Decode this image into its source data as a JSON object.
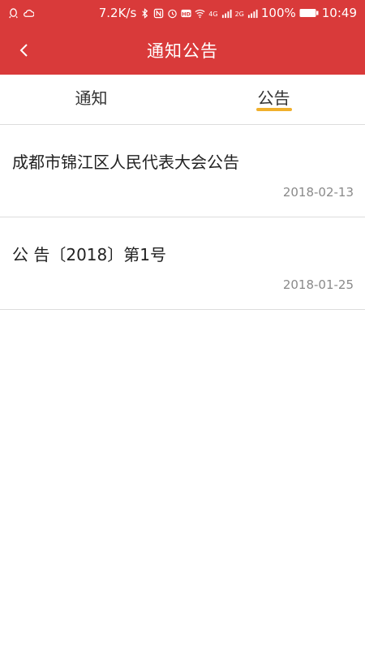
{
  "status_bar": {
    "speed": "7.2K/s",
    "network_4g": "4G",
    "network_2g": "2G",
    "battery": "100%",
    "time": "10:49",
    "icons": [
      "qq-icon",
      "cloud-icon",
      "bluetooth-icon",
      "nfc-icon",
      "alarm-icon",
      "hd-icon",
      "wifi-icon",
      "signal-icon",
      "battery-icon"
    ]
  },
  "header": {
    "title": "通知公告",
    "back_icon": "chevron-left-icon"
  },
  "tabs": [
    {
      "label": "通知",
      "active": false
    },
    {
      "label": "公告",
      "active": true
    }
  ],
  "colors": {
    "brand": "#d93a3a",
    "tab_indicator": "#f0b02c"
  },
  "announcements": [
    {
      "title": "成都市锦江区人民代表大会公告",
      "date": "2018-02-13"
    },
    {
      "title": "公 告〔2018〕第1号",
      "date": "2018-01-25"
    }
  ]
}
